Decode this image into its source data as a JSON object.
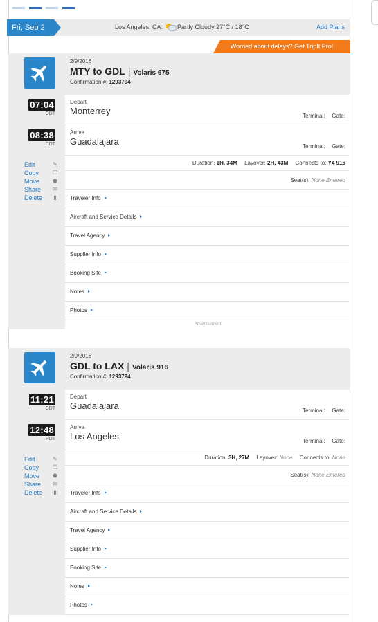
{
  "window": {
    "top_tabs": 4
  },
  "day": {
    "date": "Fri, Sep 2",
    "location": "Los Angeles, CA:",
    "weather": "Partly Cloudy 27°C / 18°C",
    "weather_icon": "partly-cloudy-icon",
    "add_plans": "Add Plans"
  },
  "promo": {
    "text": "Worried about delays? Get TripIt Pro!"
  },
  "actions": {
    "edit": "Edit",
    "copy": "Copy",
    "move": "Move",
    "share": "Share",
    "delete": "Delete"
  },
  "labels": {
    "depart": "Depart",
    "arrive": "Arrive",
    "terminal": "Terminal:",
    "gate": "Gate:",
    "duration": "Duration:",
    "layover": "Layover:",
    "connects_to": "Connects to:",
    "seats": "Seat(s):",
    "confirmation": "Confirmation #:",
    "advertisement": "Advertisement"
  },
  "sections": [
    "Traveler Info",
    "Aircraft and Service Details",
    "Travel Agency",
    "Supplier Info",
    "Booking Site",
    "Notes",
    "Photos"
  ],
  "segments": [
    {
      "date": "2/9/2016",
      "route": "MTY to GDL",
      "carrier": "Volaris 675",
      "confirmation": "1293794",
      "depart_time": "07:04",
      "depart_tz": "CDT",
      "arrive_time": "08:38",
      "arrive_tz": "CDT",
      "depart_city": "Monterrey",
      "arrive_city": "Guadalajara",
      "duration": "1H, 34M",
      "layover": "2H, 43M",
      "connects_to": "Y4 916",
      "seats": "None Entered"
    },
    {
      "date": "2/9/2016",
      "route": "GDL to LAX",
      "carrier": "Volaris 916",
      "confirmation": "1293794",
      "depart_time": "11:21",
      "depart_tz": "CDT",
      "arrive_time": "12:48",
      "arrive_tz": "PDT",
      "depart_city": "Guadalajara",
      "arrive_city": "Los Angeles",
      "duration": "3H, 27M",
      "layover": "None",
      "connects_to": "None",
      "seats": "None Entered"
    }
  ],
  "colors": {
    "accent": "#2a86c8",
    "promo": "#f07b1c",
    "panel": "#ececec",
    "link": "#2a7cc7"
  }
}
